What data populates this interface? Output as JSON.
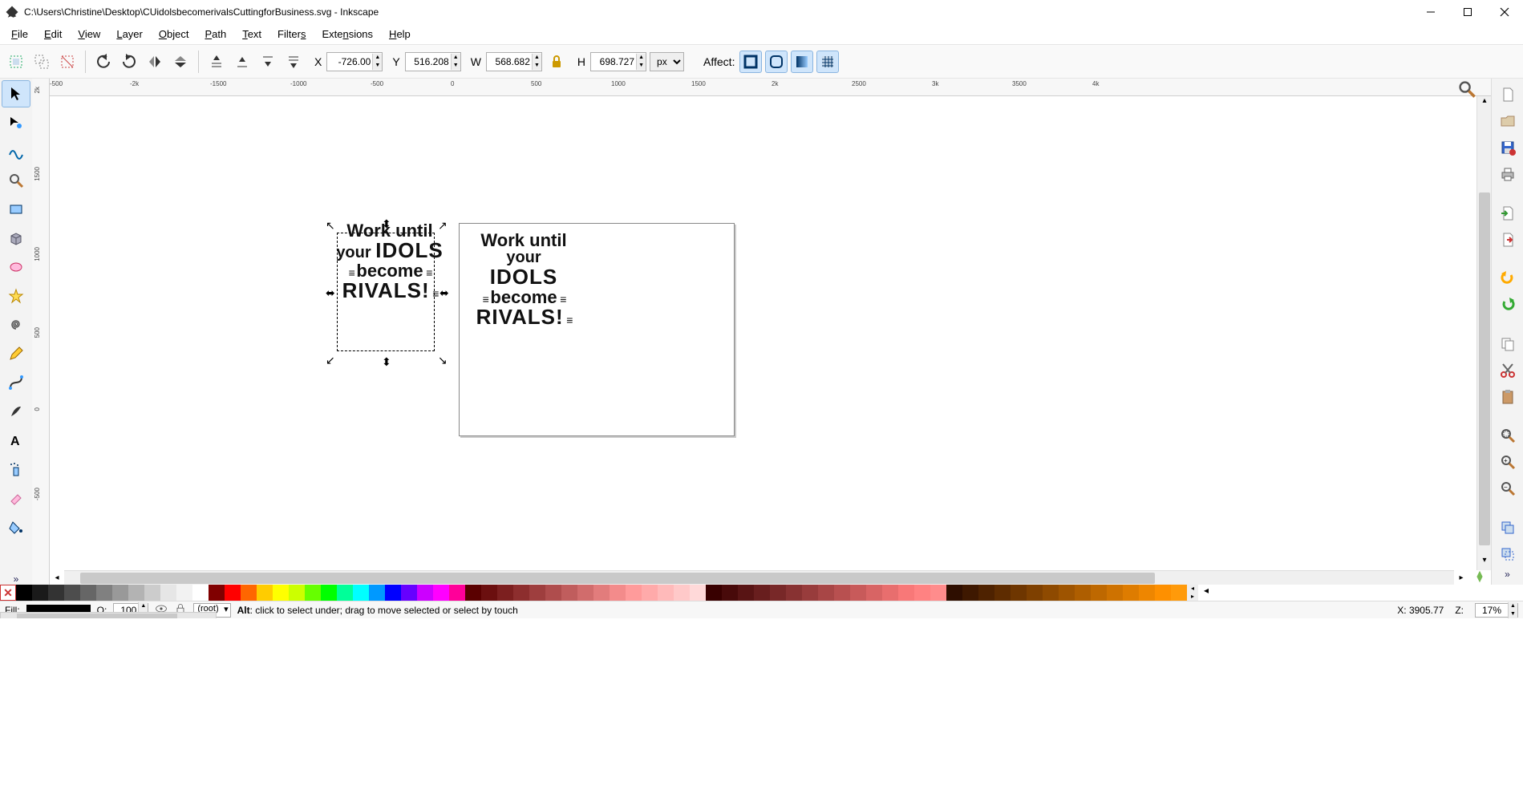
{
  "window": {
    "title": "C:\\Users\\Christine\\Desktop\\CUidolsbecomerivalsCuttingforBusiness.svg - Inkscape"
  },
  "menu": {
    "file": "File",
    "edit": "Edit",
    "view": "View",
    "layer": "Layer",
    "object": "Object",
    "path": "Path",
    "text": "Text",
    "filters": "Filters",
    "extensions": "Extensions",
    "help": "Help"
  },
  "toolbar": {
    "x_label": "X",
    "x_value": "-726.00",
    "y_label": "Y",
    "y_value": "516.208",
    "w_label": "W",
    "w_value": "568.682",
    "h_label": "H",
    "h_value": "698.727",
    "unit": "px",
    "affect_label": "Affect:"
  },
  "ruler_h_ticks": [
    "-500",
    "-2k",
    "-1500",
    "-1000",
    "-500",
    "0",
    "500",
    "1000",
    "1500",
    "2k",
    "2500",
    "3k",
    "3500",
    "4k"
  ],
  "ruler_v_ticks": [
    "2k",
    "1500",
    "1000",
    "500",
    "0",
    "-500"
  ],
  "artwork": {
    "line1": "Work until",
    "line2a": "your ",
    "line2b": "IDOLS",
    "line3": "become",
    "line4": "RIVALS!"
  },
  "palette_basic": [
    "#000000",
    "#1a1a1a",
    "#333333",
    "#4d4d4d",
    "#666666",
    "#808080",
    "#999999",
    "#b3b3b3",
    "#cccccc",
    "#e6e6e6",
    "#f2f2f2",
    "#ffffff",
    "#800000",
    "#ff0000",
    "#ff6600",
    "#ffcc00",
    "#ffff00",
    "#ccff00",
    "#66ff00",
    "#00ff00",
    "#00ff99",
    "#00ffff",
    "#0099ff",
    "#0000ff",
    "#6600ff",
    "#cc00ff",
    "#ff00ff",
    "#ff0099"
  ],
  "palette_reds": [
    "#5a0000",
    "#6b0f0f",
    "#7c1f1f",
    "#8d2e2e",
    "#9e3e3e",
    "#af4d4d",
    "#c05d5d",
    "#d16c6c",
    "#e27c7c",
    "#f38b8b",
    "#ff9b9b",
    "#ffaaaa",
    "#ffbaba",
    "#ffc9c9",
    "#ffd9d9",
    "#380000",
    "#480a0a",
    "#581414",
    "#681e1e",
    "#782828",
    "#883232",
    "#983c3c",
    "#a84646",
    "#b85050",
    "#c85a5a",
    "#d86464",
    "#e86e6e",
    "#f87878",
    "#ff8282",
    "#ff8c8c",
    "#2e0e00",
    "#3e1800",
    "#4e2200",
    "#5e2c00",
    "#6e3600",
    "#7e4000",
    "#8e4a00",
    "#9e5400",
    "#ae5e00",
    "#be6800",
    "#ce7200",
    "#de7c00",
    "#ee8600",
    "#fe9000",
    "#ff9a0a"
  ],
  "status": {
    "fill_label": "Fill:",
    "opacity_label": "O:",
    "opacity_value": "100",
    "layer_value": "(root)",
    "hint_prefix": "Alt",
    "hint_rest": ": click to select under; drag to move selected or select by touch",
    "x_label": "X:",
    "x_value": "3905.77",
    "z_label": "Z:",
    "z_value": "17%"
  }
}
